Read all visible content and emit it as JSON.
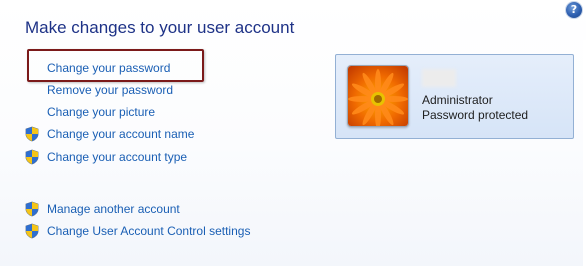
{
  "header": {
    "title": "Make changes to your user account",
    "help_icon": "help-icon",
    "help_glyph": "?"
  },
  "tasks": {
    "change_password": "Change your password",
    "remove_password": "Remove your password",
    "change_picture": "Change your picture",
    "change_name": "Change your account name",
    "change_type": "Change your account type"
  },
  "other_tasks": {
    "manage_another": "Manage another account",
    "uac_settings": "Change User Account Control settings"
  },
  "account": {
    "type": "Administrator",
    "status": "Password protected"
  },
  "colors": {
    "link": "#1a5fb4",
    "title": "#1e3287",
    "highlight": "#7b1a1a",
    "card_border": "#93b0d4"
  }
}
